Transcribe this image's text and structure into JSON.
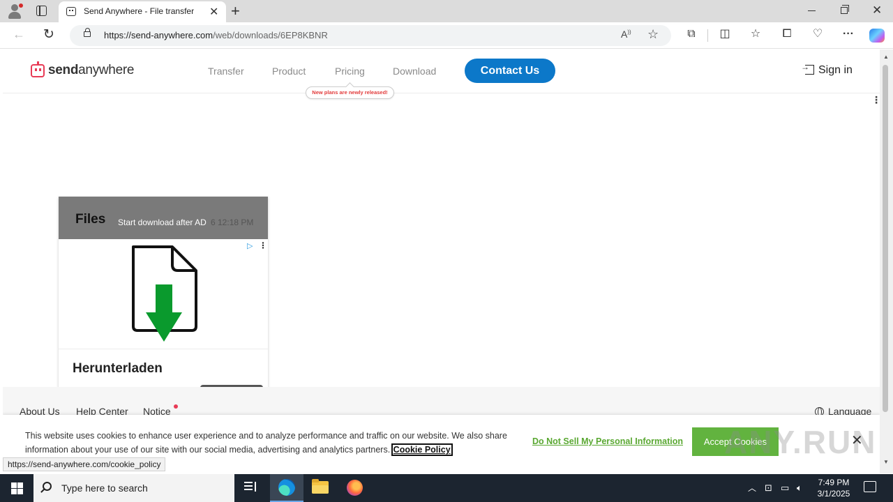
{
  "browser": {
    "tab_title": "Send Anywhere - File transfer",
    "url_prefix": "https://send-anywhere.com",
    "url_path": "/web/downloads/6EP8KBNR",
    "status_url": "https://send-anywhere.com/cookie_policy",
    "icons": [
      "profile-icon",
      "tab-actions-icon",
      "close-icon",
      "new-tab-icon",
      "back-icon",
      "reload-icon",
      "lock-icon",
      "read-aloud-icon",
      "favorite-star-icon",
      "extensions-icon",
      "split-screen-icon",
      "favorites-icon",
      "collections-icon",
      "browser-essentials-icon",
      "more-icon",
      "copilot-icon"
    ]
  },
  "site": {
    "logo_bold": "send",
    "logo_rest": "anywhere",
    "nav": [
      "Transfer",
      "Product",
      "Pricing",
      "Download"
    ],
    "pricing_bubble": "New plans are newly released!",
    "contact_button": "Contact Us",
    "signin": "Sign in"
  },
  "files_card": {
    "title": "Files",
    "start_download": "Start download after AD",
    "time": "6 12:18 PM",
    "ad_title": "Herunterladen"
  },
  "footer": {
    "links": [
      "About Us",
      "Help Center",
      "Notice"
    ],
    "language": "Language"
  },
  "cookie": {
    "text": "This website uses cookies to enhance user experience and to analyze performance and traffic on our website. We also share information about your use of our site with our social media, advertising and analytics partners.",
    "policy_link": "Cookie Policy",
    "dns_link": "Do Not Sell My Personal Information",
    "accept": "Accept Cookies",
    "watermark": "ANY.RUN"
  },
  "taskbar": {
    "search_placeholder": "Type here to search",
    "time": "7:49 PM",
    "date": "3/1/2025"
  },
  "colors": {
    "brand_red": "#e83b56",
    "contact_blue": "#0c78c9",
    "accept_green": "#62b33f",
    "download_green": "#0a9a2d"
  }
}
